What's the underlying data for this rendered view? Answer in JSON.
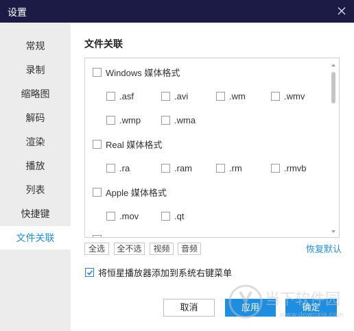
{
  "window": {
    "title": "设置"
  },
  "sidebar": {
    "items": [
      {
        "label": "常规"
      },
      {
        "label": "录制"
      },
      {
        "label": "缩略图"
      },
      {
        "label": "解码"
      },
      {
        "label": "渲染"
      },
      {
        "label": "播放"
      },
      {
        "label": "列表"
      },
      {
        "label": "快捷键"
      },
      {
        "label": "文件关联"
      }
    ],
    "active_index": 8
  },
  "main": {
    "section_title": "文件关联",
    "groups": [
      {
        "label": "Windows 媒体格式",
        "checked": false,
        "extensions": [
          ".asf",
          ".avi",
          ".wm",
          ".wmv",
          ".wmp",
          ".wma"
        ]
      },
      {
        "label": "Real 媒体格式",
        "checked": false,
        "extensions": [
          ".ra",
          ".ram",
          ".rm",
          ".rmvb"
        ]
      },
      {
        "label": "Apple 媒体格式",
        "checked": false,
        "extensions": [
          ".mov",
          ".qt"
        ]
      }
    ],
    "filter_buttons": {
      "select_all": "全选",
      "select_none": "全不选",
      "video": "视频",
      "audio": "音频"
    },
    "restore_default": "恢复默认",
    "context_menu_option": {
      "label": "将恒星播放器添加到系统右键菜单",
      "checked": true
    }
  },
  "footer": {
    "cancel": "取消",
    "apply": "应用",
    "ok": "确定"
  },
  "watermark": {
    "name": "当下软件园",
    "url": "www.downxia.com"
  },
  "colors": {
    "titlebar": "#1b1b45",
    "accent": "#1e8fe0",
    "sidebar_bg": "#ececec",
    "active_text": "#1e90dc"
  }
}
